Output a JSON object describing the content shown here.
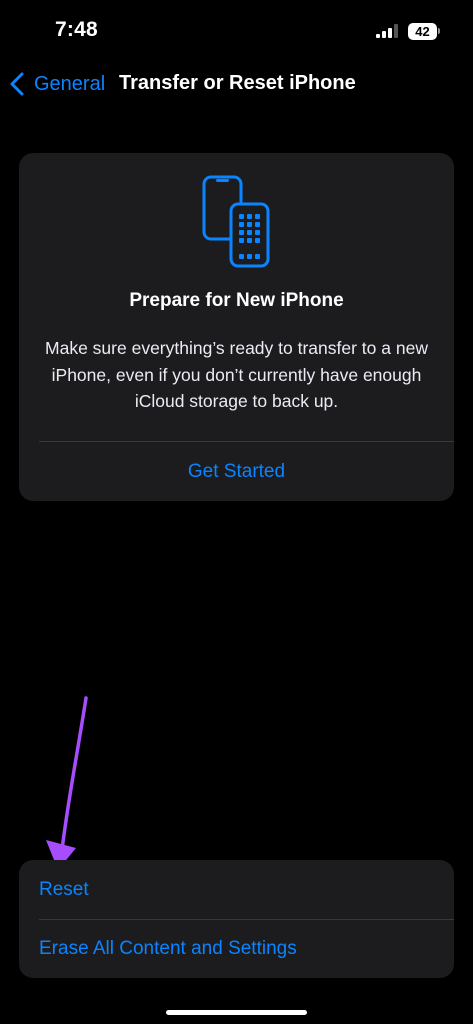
{
  "status_bar": {
    "time": "7:48",
    "battery_level": "42",
    "signal_icon": "cellular-signal-icon"
  },
  "nav": {
    "back_label": "General",
    "back_icon": "chevron-left-icon",
    "title": "Transfer or Reset iPhone"
  },
  "prepare_card": {
    "icon": "two-phones-icon",
    "title": "Prepare for New iPhone",
    "description": "Make sure everything’s ready to transfer to a new iPhone, even if you don’t currently have enough iCloud storage to back up.",
    "action_label": "Get Started"
  },
  "reset_group": {
    "items": [
      {
        "label": "Reset"
      },
      {
        "label": "Erase All Content and Settings"
      }
    ]
  },
  "colors": {
    "background": "#000000",
    "card": "#1c1c1e",
    "accent": "#0a84ff",
    "annotation_arrow": "#a64dff"
  }
}
